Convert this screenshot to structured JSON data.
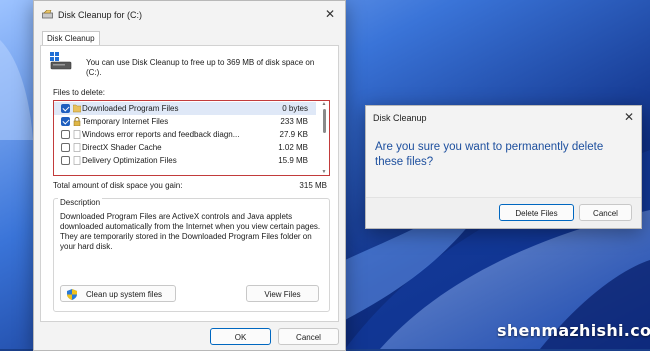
{
  "colors": {
    "wallpaper_dark": "#0d2466",
    "wallpaper_mid": "#1d4fb8",
    "wallpaper_light": "#8fb8ff",
    "accent": "#0067c0",
    "message_text": "#1d4f9e"
  },
  "main_dialog": {
    "title": "Disk Cleanup for  (C:)",
    "close_glyph": "✕",
    "tab_label": "Disk Cleanup",
    "intro_text": "You can use Disk Cleanup to free up to 369 MB of disk space on (C:).",
    "files_label": "Files to delete:",
    "files": [
      {
        "name": "Downloaded Program Files",
        "size": "0 bytes",
        "checked": true,
        "icon": "folder-icon"
      },
      {
        "name": "Temporary Internet Files",
        "size": "233 MB",
        "checked": true,
        "icon": "lock-icon"
      },
      {
        "name": "Windows error reports and feedback diagn...",
        "size": "27.9 KB",
        "checked": false,
        "icon": "blank-file-icon"
      },
      {
        "name": "DirectX Shader Cache",
        "size": "1.02 MB",
        "checked": false,
        "icon": "blank-file-icon"
      },
      {
        "name": "Delivery Optimization Files",
        "size": "15.9 MB",
        "checked": false,
        "icon": "blank-file-icon"
      }
    ],
    "total_label": "Total amount of disk space you gain:",
    "total_value": "315 MB",
    "description_title": "Description",
    "description_text": "Downloaded Program Files are ActiveX controls and Java applets downloaded automatically from the Internet when you view certain pages. They are temporarily stored in the Downloaded Program Files folder on your hard disk.",
    "cleanup_system_button": "Clean up system files",
    "view_files_button": "View Files",
    "ok_button": "OK",
    "cancel_button": "Cancel"
  },
  "confirm_dialog": {
    "title": "Disk Cleanup",
    "close_glyph": "✕",
    "message": "Are you sure you want to permanently delete these files?",
    "delete_button": "Delete Files",
    "cancel_button": "Cancel"
  },
  "watermark": "shenmazhishi.com"
}
